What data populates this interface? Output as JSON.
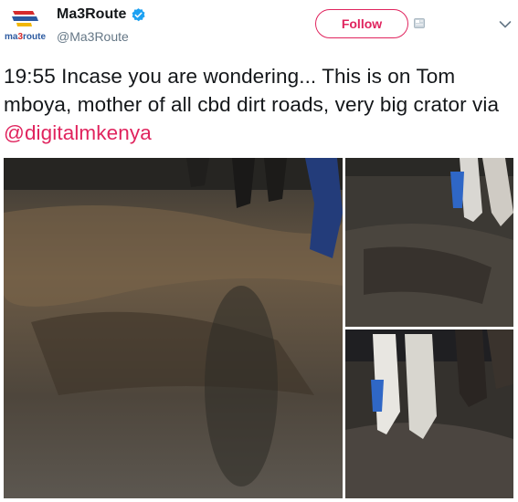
{
  "account": {
    "name": "Ma3Route",
    "handle": "@Ma3Route",
    "logo_text": "ma3route",
    "verified": true
  },
  "actions": {
    "follow_label": "Follow",
    "menu_icon": "chevron-down-icon",
    "extra_icon": "card-icon"
  },
  "tweet": {
    "text_part1": "19:55 Incase you are wondering... This is on Tom mboya, mother of all cbd dirt roads, very big crator   via ",
    "mention": "@digitalmkenya"
  },
  "media": {
    "photos": [
      "photo-main-road-crater",
      "photo-top-right-pedestrians",
      "photo-bottom-right-pedestrians"
    ]
  },
  "colors": {
    "accent": "#e0245e",
    "verified": "#1da1f2",
    "secondary_text": "#657786",
    "logo_red": "#d62b2b",
    "logo_blue": "#2c5aa0"
  }
}
